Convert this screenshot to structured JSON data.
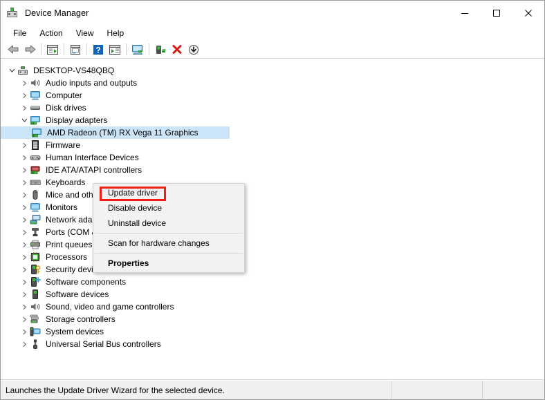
{
  "window": {
    "title": "Device Manager",
    "icon": "device-manager-icon",
    "controls": {
      "minimize": "minimize-icon",
      "maximize": "maximize-icon",
      "close": "close-icon"
    }
  },
  "menubar": {
    "items": [
      {
        "label": "File"
      },
      {
        "label": "Action"
      },
      {
        "label": "View"
      },
      {
        "label": "Help"
      }
    ]
  },
  "toolbar": {
    "buttons": [
      {
        "name": "back-icon",
        "title": "Back"
      },
      {
        "name": "forward-icon",
        "title": "Forward"
      },
      {
        "name": "separator-1",
        "title": ""
      },
      {
        "name": "show-hide-console-tree-icon",
        "title": "Show/Hide Console Tree"
      },
      {
        "name": "separator-2",
        "title": ""
      },
      {
        "name": "properties-icon",
        "title": "Properties"
      },
      {
        "name": "separator-3",
        "title": ""
      },
      {
        "name": "help-icon",
        "title": "Help"
      },
      {
        "name": "show-hide-action-pane-icon",
        "title": "Show/Hide Action Pane"
      },
      {
        "name": "separator-4",
        "title": ""
      },
      {
        "name": "scan-for-hardware-changes-icon",
        "title": "Scan for hardware changes"
      },
      {
        "name": "separator-5",
        "title": ""
      },
      {
        "name": "update-driver-icon",
        "title": "Update Driver"
      },
      {
        "name": "uninstall-device-icon",
        "title": "Uninstall device"
      },
      {
        "name": "disable-device-icon",
        "title": "Disable device"
      }
    ]
  },
  "tree": {
    "root": {
      "label": "DESKTOP-VS48QBQ",
      "icon": "computer-root-icon",
      "expanded": true
    },
    "items": [
      {
        "label": "Audio inputs and outputs",
        "icon": "speaker-icon",
        "expanded": false,
        "level": 1
      },
      {
        "label": "Computer",
        "icon": "monitor-icon",
        "expanded": false,
        "level": 1
      },
      {
        "label": "Disk drives",
        "icon": "disk-drive-icon",
        "expanded": false,
        "level": 1
      },
      {
        "label": "Display adapters",
        "icon": "display-adapter-icon",
        "expanded": true,
        "level": 1
      },
      {
        "label": "AMD Radeon (TM) RX Vega 11 Graphics",
        "icon": "display-adapter-icon",
        "expanded": null,
        "level": 2,
        "selected": true
      },
      {
        "label": "Firmware",
        "icon": "firmware-icon",
        "expanded": false,
        "level": 1
      },
      {
        "label": "Human Interface Devices",
        "icon": "hid-icon",
        "expanded": false,
        "level": 1
      },
      {
        "label": "IDE ATA/ATAPI controllers",
        "icon": "ide-controller-icon",
        "expanded": false,
        "level": 1
      },
      {
        "label": "Keyboards",
        "icon": "keyboard-icon",
        "expanded": false,
        "level": 1
      },
      {
        "label": "Mice and other pointing devices",
        "icon": "mouse-icon",
        "expanded": false,
        "level": 1
      },
      {
        "label": "Monitors",
        "icon": "monitor-icon",
        "expanded": false,
        "level": 1
      },
      {
        "label": "Network adapters",
        "icon": "network-adapter-icon",
        "expanded": false,
        "level": 1
      },
      {
        "label": "Ports (COM & LPT)",
        "icon": "port-icon",
        "expanded": false,
        "level": 1
      },
      {
        "label": "Print queues",
        "icon": "printer-icon",
        "expanded": false,
        "level": 1
      },
      {
        "label": "Processors",
        "icon": "processor-icon",
        "expanded": false,
        "level": 1
      },
      {
        "label": "Security devices",
        "icon": "security-device-icon",
        "expanded": false,
        "level": 1
      },
      {
        "label": "Software components",
        "icon": "software-component-icon",
        "expanded": false,
        "level": 1
      },
      {
        "label": "Software devices",
        "icon": "software-device-icon",
        "expanded": false,
        "level": 1
      },
      {
        "label": "Sound, video and game controllers",
        "icon": "speaker-icon",
        "expanded": false,
        "level": 1
      },
      {
        "label": "Storage controllers",
        "icon": "storage-controller-icon",
        "expanded": false,
        "level": 1
      },
      {
        "label": "System devices",
        "icon": "system-device-icon",
        "expanded": false,
        "level": 1
      },
      {
        "label": "Universal Serial Bus controllers",
        "icon": "usb-controller-icon",
        "expanded": false,
        "level": 1
      }
    ]
  },
  "context_menu": {
    "items": [
      {
        "label": "Update driver",
        "bold": false,
        "highlighted": true
      },
      {
        "label": "Disable device",
        "bold": false,
        "highlighted": false
      },
      {
        "label": "Uninstall device",
        "bold": false,
        "highlighted": false
      },
      {
        "separator": true
      },
      {
        "label": "Scan for hardware changes",
        "bold": false,
        "highlighted": false
      },
      {
        "separator": true
      },
      {
        "label": "Properties",
        "bold": true,
        "highlighted": false
      }
    ],
    "highlight_color": "#ef1d14"
  },
  "statusbar": {
    "message": "Launches the Update Driver Wizard for the selected device.",
    "panel2": "",
    "panel3": ""
  },
  "colors": {
    "selection": "#cce4f7",
    "annotation": "#ef1d14",
    "menu_bg": "#f2f2f2",
    "status_bg": "#f0f0f0"
  }
}
